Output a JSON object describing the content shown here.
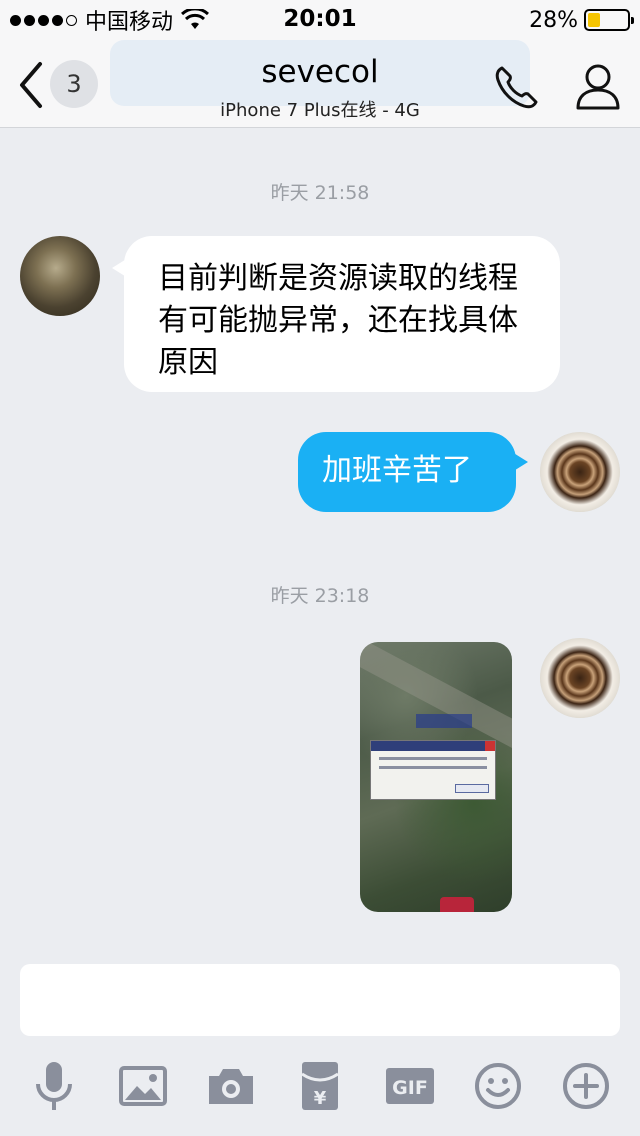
{
  "status_bar": {
    "carrier": "中国移动",
    "time": "20:01",
    "battery_percent_text": "28%",
    "battery_level": 0.28,
    "signal_dots_filled": 4,
    "signal_dots_total": 5
  },
  "nav": {
    "unread_count": "3",
    "title": "sevecol",
    "subtitle": "iPhone 7 Plus在线 - 4G"
  },
  "conversation": {
    "timestamps": [
      "昨天 21:58",
      "昨天 23:18"
    ],
    "messages": [
      {
        "direction": "incoming",
        "type": "text",
        "text": "目前判断是资源读取的线程有可能抛异常，还在找具体原因"
      },
      {
        "direction": "outgoing",
        "type": "text",
        "text": "加班辛苦了"
      },
      {
        "direction": "outgoing",
        "type": "image"
      }
    ]
  },
  "input": {
    "value": "",
    "placeholder": ""
  },
  "toolbar": {
    "gif_label": "GIF",
    "icons": [
      "microphone-icon",
      "image-icon",
      "camera-icon",
      "red-packet-icon",
      "gif-icon",
      "emoji-icon",
      "plus-icon"
    ]
  },
  "colors": {
    "outgoing_bubble": "#1ab0f4",
    "incoming_bubble": "#ffffff",
    "background": "#ebedf1",
    "icon_gray": "#8a8f9c",
    "battery_fill": "#f5c400"
  }
}
